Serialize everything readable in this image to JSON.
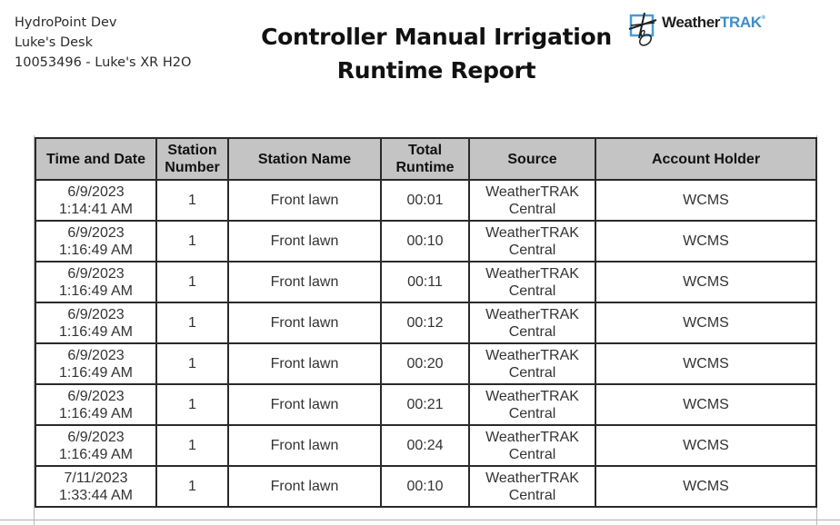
{
  "header": {
    "org_lines": [
      "HydroPoint Dev",
      "Luke's Desk",
      "10053496 - Luke's XR H2O"
    ],
    "title_line1": "Controller Manual Irrigation",
    "title_line2": "Runtime Report",
    "logo": {
      "icon": "weathertrak-logo-icon",
      "text_dark": "Weather",
      "text_accent": "TRAK",
      "trademark": "®",
      "accent_color": "#3b8fc8"
    }
  },
  "table": {
    "header_bg": "#c4c4c4",
    "columns": [
      "Time and Date",
      "Station Number",
      "Station Name",
      "Total Runtime",
      "Source",
      "Account Holder"
    ],
    "column_lines": [
      [
        "Time and Date"
      ],
      [
        "Station",
        "Number"
      ],
      [
        "Station Name"
      ],
      [
        "Total",
        "Runtime"
      ],
      [
        "Source"
      ],
      [
        "Account Holder"
      ]
    ],
    "rows": [
      {
        "date": "6/9/2023",
        "time": "1:14:41 AM",
        "station_number": "1",
        "station_name": "Front lawn",
        "runtime": "00:01",
        "source_1": "WeatherTRAK",
        "source_2": "Central",
        "account_holder": "WCMS"
      },
      {
        "date": "6/9/2023",
        "time": "1:16:49 AM",
        "station_number": "1",
        "station_name": "Front lawn",
        "runtime": "00:10",
        "source_1": "WeatherTRAK",
        "source_2": "Central",
        "account_holder": "WCMS"
      },
      {
        "date": "6/9/2023",
        "time": "1:16:49 AM",
        "station_number": "1",
        "station_name": "Front lawn",
        "runtime": "00:11",
        "source_1": "WeatherTRAK",
        "source_2": "Central",
        "account_holder": "WCMS"
      },
      {
        "date": "6/9/2023",
        "time": "1:16:49 AM",
        "station_number": "1",
        "station_name": "Front lawn",
        "runtime": "00:12",
        "source_1": "WeatherTRAK",
        "source_2": "Central",
        "account_holder": "WCMS"
      },
      {
        "date": "6/9/2023",
        "time": "1:16:49 AM",
        "station_number": "1",
        "station_name": "Front lawn",
        "runtime": "00:20",
        "source_1": "WeatherTRAK",
        "source_2": "Central",
        "account_holder": "WCMS"
      },
      {
        "date": "6/9/2023",
        "time": "1:16:49 AM",
        "station_number": "1",
        "station_name": "Front lawn",
        "runtime": "00:21",
        "source_1": "WeatherTRAK",
        "source_2": "Central",
        "account_holder": "WCMS"
      },
      {
        "date": "6/9/2023",
        "time": "1:16:49 AM",
        "station_number": "1",
        "station_name": "Front lawn",
        "runtime": "00:24",
        "source_1": "WeatherTRAK",
        "source_2": "Central",
        "account_holder": "WCMS"
      },
      {
        "date": "7/11/2023",
        "time": "1:33:44 AM",
        "station_number": "1",
        "station_name": "Front lawn",
        "runtime": "00:10",
        "source_1": "WeatherTRAK",
        "source_2": "Central",
        "account_holder": "WCMS"
      }
    ]
  }
}
